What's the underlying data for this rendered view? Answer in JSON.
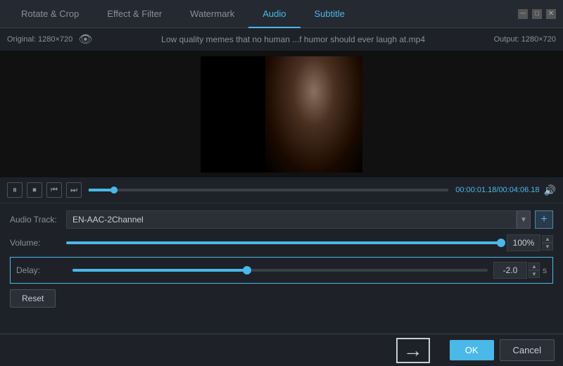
{
  "tabs": [
    {
      "id": "rotate-crop",
      "label": "Rotate & Crop",
      "active": false
    },
    {
      "id": "effect-filter",
      "label": "Effect & Filter",
      "active": false
    },
    {
      "id": "watermark",
      "label": "Watermark",
      "active": false
    },
    {
      "id": "audio",
      "label": "Audio",
      "active": true
    },
    {
      "id": "subtitle",
      "label": "Subtitle",
      "active": false,
      "highlighted": true
    }
  ],
  "window": {
    "min_label": "─",
    "max_label": "□",
    "close_label": "✕"
  },
  "preview": {
    "original_label": "Original: 1280×720",
    "output_label": "Output: 1280×720",
    "filename": "Low quality memes that no human ...f humor should ever laugh at.mp4"
  },
  "playback": {
    "pause_icon": "⏸",
    "stop_icon": "⏹",
    "prev_icon": "⏮",
    "next_icon": "⏭",
    "time_current": "00:00:01.18",
    "time_separator": "/",
    "time_total": "00:04:06.18",
    "volume_icon": "🔊",
    "progress_percent": 7
  },
  "audio": {
    "track_label": "Audio Track:",
    "track_value": "EN-AAC-2Channel",
    "add_btn_label": "+",
    "volume_label": "Volume:",
    "volume_value": "100%",
    "volume_percent": 100,
    "delay_label": "Delay:",
    "delay_value": "-2.0",
    "delay_unit": "s",
    "delay_percent": 42,
    "reset_label": "Reset"
  },
  "bottom": {
    "ok_label": "OK",
    "cancel_label": "Cancel"
  }
}
